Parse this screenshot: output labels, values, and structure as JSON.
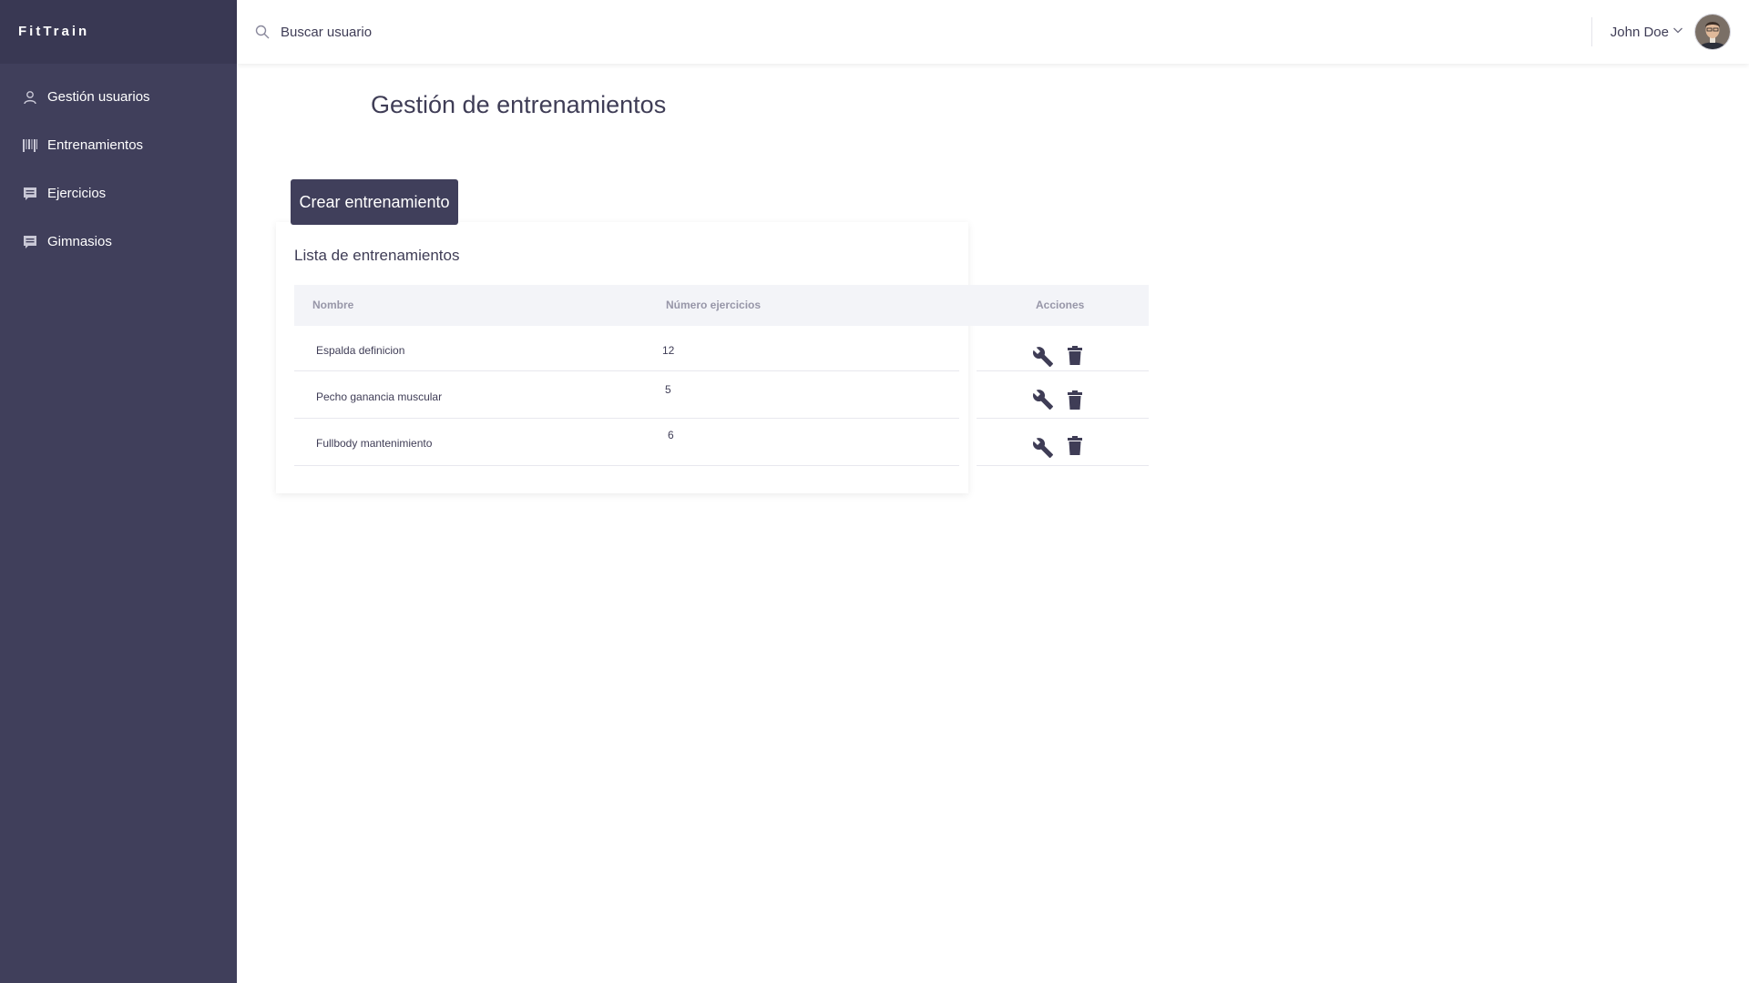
{
  "app": {
    "brand": "FitTrain"
  },
  "sidebar": {
    "items": [
      {
        "label": "Gestión usuarios",
        "icon": "user-icon"
      },
      {
        "label": "Entrenamientos",
        "icon": "barcode-icon"
      },
      {
        "label": "Ejercicios",
        "icon": "list-icon"
      },
      {
        "label": "Gimnasios",
        "icon": "list-icon"
      }
    ]
  },
  "topbar": {
    "search_placeholder": "Buscar usuario",
    "user_name": "John Doe"
  },
  "main": {
    "title": "Gestión de entrenamientos",
    "create_button": "Crear entrenamiento",
    "list_title": "Lista de entrenamientos",
    "columns": [
      "Nombre",
      "Número ejercicios",
      "Acciones"
    ],
    "rows": [
      {
        "name": "Espalda definicion",
        "count": "12"
      },
      {
        "name": "Pecho ganancia muscular",
        "count": "5"
      },
      {
        "name": "Fullbody mantenimiento",
        "count": "6"
      }
    ]
  },
  "colors": {
    "sidebar": "#403f5b",
    "brand_bar": "#393853",
    "accent": "#403f5b",
    "table_header": "#f3f4f8"
  }
}
